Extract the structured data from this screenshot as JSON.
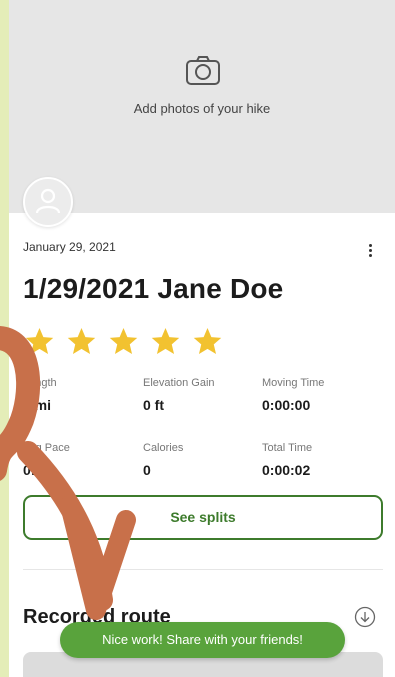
{
  "photo_area": {
    "caption": "Add photos of your hike",
    "icon": "camera-icon"
  },
  "activity": {
    "date": "January 29, 2021",
    "title": "1/29/2021 Jane Doe",
    "rating": {
      "value": 5,
      "max": 5,
      "color": "#f2c230"
    }
  },
  "stats": [
    {
      "label": "Length",
      "value": "0 mi"
    },
    {
      "label": "Elevation Gain",
      "value": "0 ft"
    },
    {
      "label": "Moving Time",
      "value": "0:00:00"
    },
    {
      "label": "Avg Pace",
      "value": "0:00"
    },
    {
      "label": "Calories",
      "value": "0"
    },
    {
      "label": "Total Time",
      "value": "0:00:02"
    }
  ],
  "splits_button": {
    "label": "See splits"
  },
  "route_section": {
    "title": "Recorded route"
  },
  "toast": {
    "message": "Nice work! Share with your friends!"
  },
  "colors": {
    "accent_green": "#3d7b2c",
    "toast_green": "#59a33c",
    "arrow": "#c8704a",
    "background": "#e4edb8"
  }
}
